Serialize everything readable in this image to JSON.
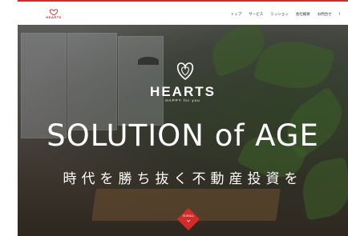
{
  "header": {
    "logo_text": "HEARTS",
    "nav": [
      "トップ",
      "サービス",
      "ミッション",
      "会社概要",
      "お問合せ",
      "f"
    ]
  },
  "hero": {
    "brand_name": "HEARTS",
    "tagline": "HAPPY for you",
    "headline": "SOLUTION of AGE",
    "subhead": "時代を勝ち抜く不動産投資を",
    "scroll_label": "SCROLL"
  },
  "colors": {
    "accent": "#d22b2b"
  }
}
